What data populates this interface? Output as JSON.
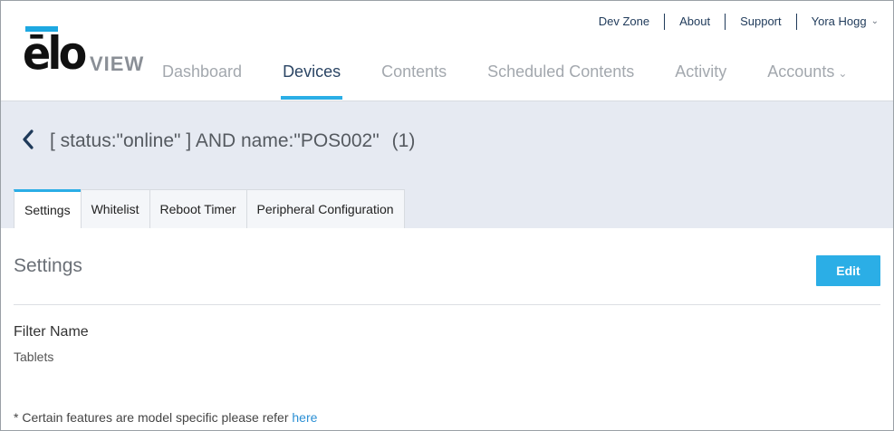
{
  "brand": {
    "logo_main": "ēlo",
    "logo_sub": "VIEW"
  },
  "top_links": {
    "dev_zone": "Dev Zone",
    "about": "About",
    "support": "Support",
    "user": "Yora Hogg"
  },
  "nav": {
    "items": [
      {
        "label": "Dashboard"
      },
      {
        "label": "Devices"
      },
      {
        "label": "Contents"
      },
      {
        "label": "Scheduled Contents"
      },
      {
        "label": "Activity"
      },
      {
        "label": "Accounts"
      }
    ],
    "active": "Devices"
  },
  "filter": {
    "query": "[ status:\"online\" ] AND name:\"POS002\"",
    "count": "(1)"
  },
  "tabs": [
    {
      "label": "Settings"
    },
    {
      "label": "Whitelist"
    },
    {
      "label": "Reboot Timer"
    },
    {
      "label": "Peripheral Configuration"
    }
  ],
  "settings": {
    "title": "Settings",
    "edit_label": "Edit",
    "filter_name_label": "Filter Name",
    "filter_name_value": "Tablets",
    "note_text": "* Certain features are model specific please refer ",
    "note_link": "here"
  },
  "colors": {
    "accent": "#2baee6",
    "nav_active": "#2b4564",
    "filter_bg": "#e6eaf2"
  },
  "icons": {
    "back": "chevron-left-icon",
    "dropdown": "chevron-down-icon"
  }
}
